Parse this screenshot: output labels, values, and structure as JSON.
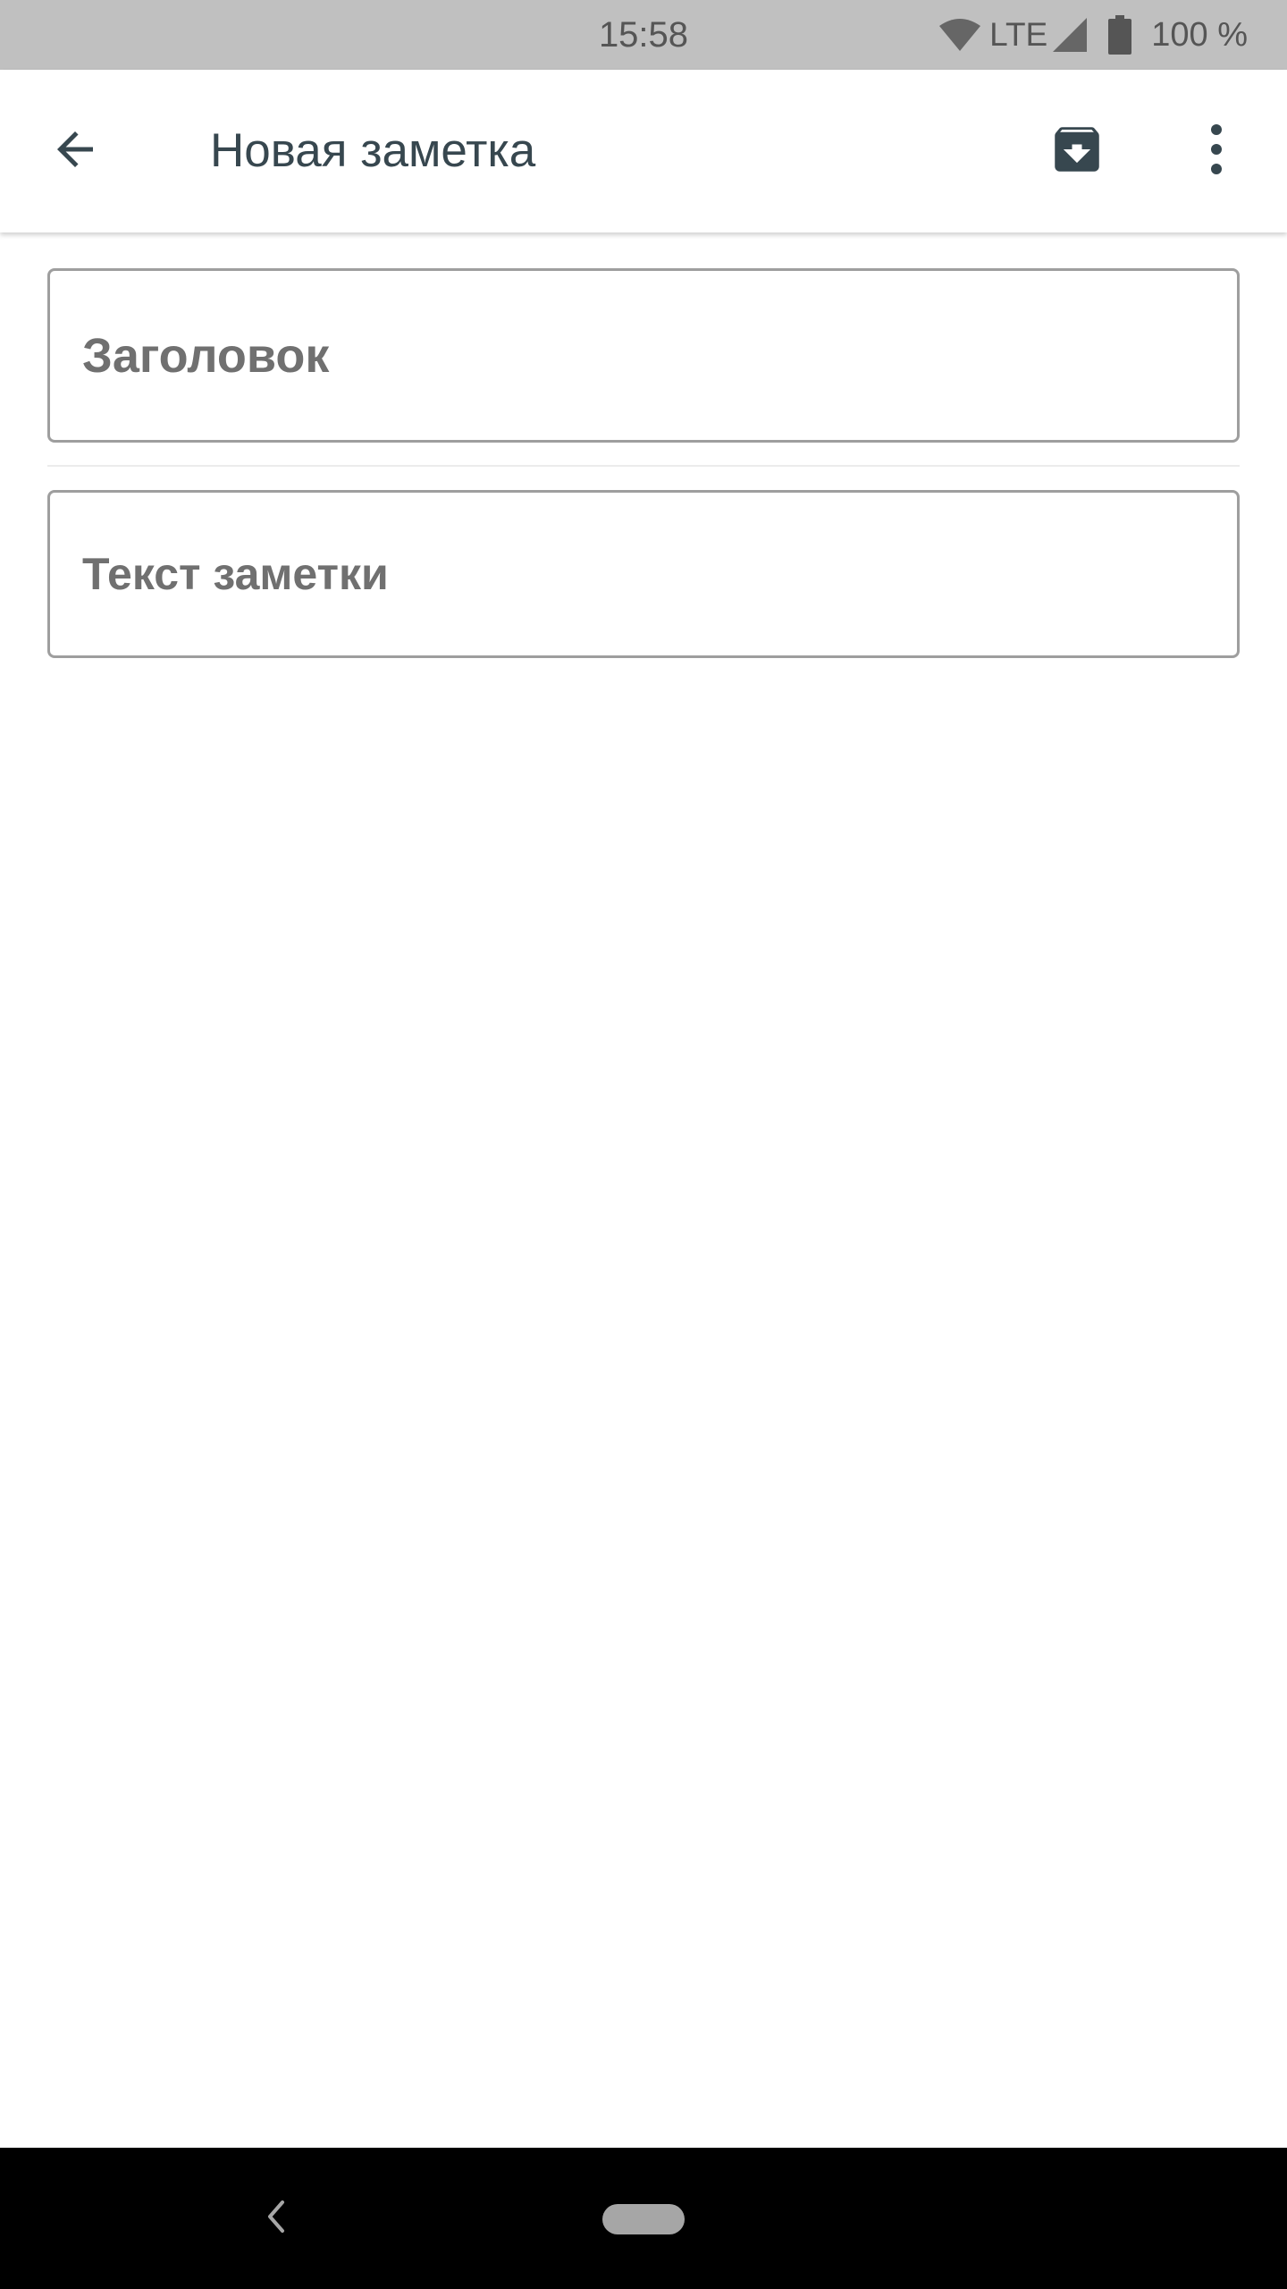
{
  "status_bar": {
    "time": "15:58",
    "network": "LTE",
    "battery": "100 %",
    "icons": [
      "wifi-icon",
      "signal-icon",
      "battery-icon"
    ]
  },
  "app_bar": {
    "title": "Новая заметка",
    "back_icon": "arrow-left-icon",
    "archive_icon": "archive-icon",
    "more_icon": "more-vert-icon"
  },
  "form": {
    "title_placeholder": "Заголовок",
    "text_placeholder": "Текст заметки"
  },
  "nav_bar": {
    "back_icon": "chevron-left-icon",
    "home_icon": "home-pill-icon"
  },
  "colors": {
    "status_bar_bg": "#c0c0c0",
    "icon_color": "#37474f",
    "field_border": "#9e9e9e",
    "placeholder": "#707070",
    "nav_bar_bg": "#000000"
  }
}
